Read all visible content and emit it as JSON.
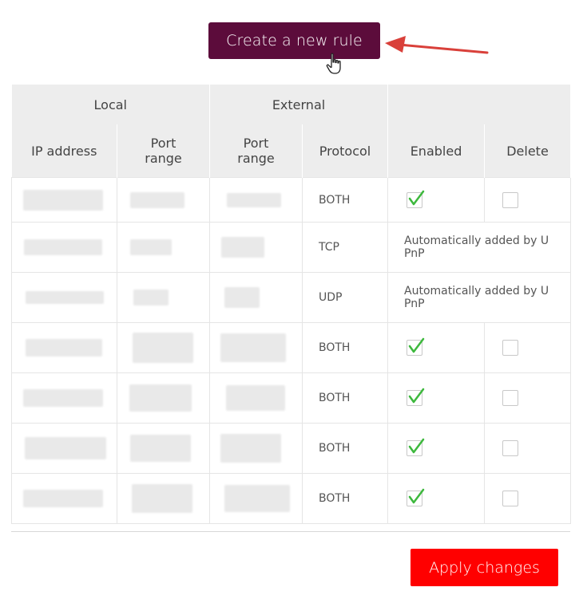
{
  "create_button": {
    "label": "Create a new rule"
  },
  "table": {
    "group_headers": {
      "local": "Local",
      "external": "External"
    },
    "columns": {
      "ip_address": "IP address",
      "local_port_range": "Port range",
      "external_port_range": "Port range",
      "protocol": "Protocol",
      "enabled": "Enabled",
      "delete": "Delete"
    },
    "rows": [
      {
        "protocol": "BOTH",
        "enabled": true,
        "deletable": true
      },
      {
        "protocol": "TCP",
        "auto_note": "Automatically added by U PnP"
      },
      {
        "protocol": "UDP",
        "auto_note": "Automatically added by U PnP"
      },
      {
        "protocol": "BOTH",
        "enabled": true,
        "deletable": true
      },
      {
        "protocol": "BOTH",
        "enabled": true,
        "deletable": true
      },
      {
        "protocol": "BOTH",
        "enabled": true,
        "deletable": true
      },
      {
        "protocol": "BOTH",
        "enabled": true,
        "deletable": true
      }
    ]
  },
  "apply_button": {
    "label": "Apply changes"
  },
  "colors": {
    "primary": "#5c0c3b",
    "apply": "#ff0000",
    "check": "#3db83d",
    "annotation_arrow": "#d9403a"
  }
}
